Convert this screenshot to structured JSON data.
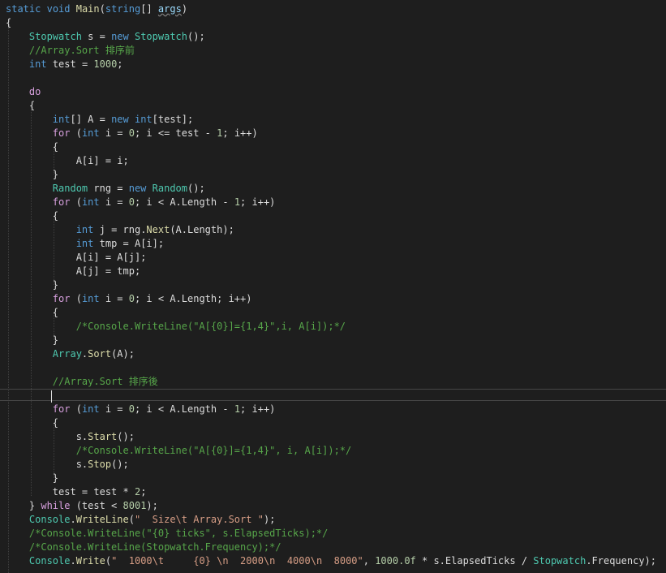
{
  "editor": {
    "lines": [
      [
        {
          "t": "static",
          "c": "kw"
        },
        {
          "t": " ",
          "c": "pl"
        },
        {
          "t": "void",
          "c": "kw"
        },
        {
          "t": " ",
          "c": "pl"
        },
        {
          "t": "Main",
          "c": "fn"
        },
        {
          "t": "(",
          "c": "pl"
        },
        {
          "t": "string",
          "c": "kw"
        },
        {
          "t": "[] ",
          "c": "pl"
        },
        {
          "t": "args",
          "c": "un"
        },
        {
          "t": ")",
          "c": "pl"
        }
      ],
      [
        {
          "t": "{",
          "c": "pl"
        }
      ],
      [
        {
          "t": "    ",
          "c": "pl"
        },
        {
          "t": "Stopwatch",
          "c": "ty"
        },
        {
          "t": " s = ",
          "c": "pl"
        },
        {
          "t": "new",
          "c": "kw"
        },
        {
          "t": " ",
          "c": "pl"
        },
        {
          "t": "Stopwatch",
          "c": "ty"
        },
        {
          "t": "();",
          "c": "pl"
        }
      ],
      [
        {
          "t": "    ",
          "c": "pl"
        },
        {
          "t": "//Array.Sort 排序前",
          "c": "cm"
        }
      ],
      [
        {
          "t": "    ",
          "c": "pl"
        },
        {
          "t": "int",
          "c": "kw"
        },
        {
          "t": " test = ",
          "c": "pl"
        },
        {
          "t": "1000",
          "c": "nm"
        },
        {
          "t": ";",
          "c": "pl"
        }
      ],
      [],
      [
        {
          "t": "    ",
          "c": "pl"
        },
        {
          "t": "do",
          "c": "ctl"
        }
      ],
      [
        {
          "t": "    {",
          "c": "pl"
        }
      ],
      [
        {
          "t": "        ",
          "c": "pl"
        },
        {
          "t": "int",
          "c": "kw"
        },
        {
          "t": "[] A = ",
          "c": "pl"
        },
        {
          "t": "new",
          "c": "kw"
        },
        {
          "t": " ",
          "c": "pl"
        },
        {
          "t": "int",
          "c": "kw"
        },
        {
          "t": "[test];",
          "c": "pl"
        }
      ],
      [
        {
          "t": "        ",
          "c": "pl"
        },
        {
          "t": "for",
          "c": "ctl"
        },
        {
          "t": " (",
          "c": "pl"
        },
        {
          "t": "int",
          "c": "kw"
        },
        {
          "t": " i = ",
          "c": "pl"
        },
        {
          "t": "0",
          "c": "nm"
        },
        {
          "t": "; i <= test - ",
          "c": "pl"
        },
        {
          "t": "1",
          "c": "nm"
        },
        {
          "t": "; i++)",
          "c": "pl"
        }
      ],
      [
        {
          "t": "        {",
          "c": "pl"
        }
      ],
      [
        {
          "t": "            A[i] = i;",
          "c": "pl"
        }
      ],
      [
        {
          "t": "        }",
          "c": "pl"
        }
      ],
      [
        {
          "t": "        ",
          "c": "pl"
        },
        {
          "t": "Random",
          "c": "ty"
        },
        {
          "t": " rng = ",
          "c": "pl"
        },
        {
          "t": "new",
          "c": "kw"
        },
        {
          "t": " ",
          "c": "pl"
        },
        {
          "t": "Random",
          "c": "ty"
        },
        {
          "t": "();",
          "c": "pl"
        }
      ],
      [
        {
          "t": "        ",
          "c": "pl"
        },
        {
          "t": "for",
          "c": "ctl"
        },
        {
          "t": " (",
          "c": "pl"
        },
        {
          "t": "int",
          "c": "kw"
        },
        {
          "t": " i = ",
          "c": "pl"
        },
        {
          "t": "0",
          "c": "nm"
        },
        {
          "t": "; i < A.Length - ",
          "c": "pl"
        },
        {
          "t": "1",
          "c": "nm"
        },
        {
          "t": "; i++)",
          "c": "pl"
        }
      ],
      [
        {
          "t": "        {",
          "c": "pl"
        }
      ],
      [
        {
          "t": "            ",
          "c": "pl"
        },
        {
          "t": "int",
          "c": "kw"
        },
        {
          "t": " j = rng.",
          "c": "pl"
        },
        {
          "t": "Next",
          "c": "fn"
        },
        {
          "t": "(A.Length);",
          "c": "pl"
        }
      ],
      [
        {
          "t": "            ",
          "c": "pl"
        },
        {
          "t": "int",
          "c": "kw"
        },
        {
          "t": " tmp = A[i];",
          "c": "pl"
        }
      ],
      [
        {
          "t": "            A[i] = A[j];",
          "c": "pl"
        }
      ],
      [
        {
          "t": "            A[j] = tmp;",
          "c": "pl"
        }
      ],
      [
        {
          "t": "        }",
          "c": "pl"
        }
      ],
      [
        {
          "t": "        ",
          "c": "pl"
        },
        {
          "t": "for",
          "c": "ctl"
        },
        {
          "t": " (",
          "c": "pl"
        },
        {
          "t": "int",
          "c": "kw"
        },
        {
          "t": " i = ",
          "c": "pl"
        },
        {
          "t": "0",
          "c": "nm"
        },
        {
          "t": "; i < A.Length; i++)",
          "c": "pl"
        }
      ],
      [
        {
          "t": "        {",
          "c": "pl"
        }
      ],
      [
        {
          "t": "            ",
          "c": "pl"
        },
        {
          "t": "/*Console.WriteLine(\"A[{0}]={1,4}\",i, A[i]);*/",
          "c": "cm"
        }
      ],
      [
        {
          "t": "        }",
          "c": "pl"
        }
      ],
      [
        {
          "t": "        ",
          "c": "pl"
        },
        {
          "t": "Array",
          "c": "ty"
        },
        {
          "t": ".",
          "c": "pl"
        },
        {
          "t": "Sort",
          "c": "fn"
        },
        {
          "t": "(A);",
          "c": "pl"
        }
      ],
      [],
      [
        {
          "t": "        ",
          "c": "pl"
        },
        {
          "t": "//Array.Sort 排序後",
          "c": "cm"
        }
      ],
      [],
      [
        {
          "t": "        ",
          "c": "pl"
        },
        {
          "t": "for",
          "c": "ctl"
        },
        {
          "t": " (",
          "c": "pl"
        },
        {
          "t": "int",
          "c": "kw"
        },
        {
          "t": " i = ",
          "c": "pl"
        },
        {
          "t": "0",
          "c": "nm"
        },
        {
          "t": "; i < A.Length - ",
          "c": "pl"
        },
        {
          "t": "1",
          "c": "nm"
        },
        {
          "t": "; i++)",
          "c": "pl"
        }
      ],
      [
        {
          "t": "        {",
          "c": "pl"
        }
      ],
      [
        {
          "t": "            s.",
          "c": "pl"
        },
        {
          "t": "Start",
          "c": "fn"
        },
        {
          "t": "();",
          "c": "pl"
        }
      ],
      [
        {
          "t": "            ",
          "c": "pl"
        },
        {
          "t": "/*Console.WriteLine(\"A[{0}]={1,4}\", i, A[i]);*/",
          "c": "cm"
        }
      ],
      [
        {
          "t": "            s.",
          "c": "pl"
        },
        {
          "t": "Stop",
          "c": "fn"
        },
        {
          "t": "();",
          "c": "pl"
        }
      ],
      [
        {
          "t": "        }",
          "c": "pl"
        }
      ],
      [
        {
          "t": "        test ",
          "c": "pl"
        },
        {
          "t": "=",
          "c": "pl"
        },
        {
          "t": " test * ",
          "c": "pl"
        },
        {
          "t": "2",
          "c": "nm"
        },
        {
          "t": ";",
          "c": "pl"
        }
      ],
      [
        {
          "t": "    } ",
          "c": "pl"
        },
        {
          "t": "while",
          "c": "ctl"
        },
        {
          "t": " (test < ",
          "c": "pl"
        },
        {
          "t": "8001",
          "c": "nm"
        },
        {
          "t": ");",
          "c": "pl"
        }
      ],
      [
        {
          "t": "    ",
          "c": "pl"
        },
        {
          "t": "Console",
          "c": "ty"
        },
        {
          "t": ".",
          "c": "pl"
        },
        {
          "t": "WriteLine",
          "c": "fn"
        },
        {
          "t": "(",
          "c": "pl"
        },
        {
          "t": "\"  Size\\t Array.Sort \"",
          "c": "st"
        },
        {
          "t": ");",
          "c": "pl"
        }
      ],
      [
        {
          "t": "    ",
          "c": "pl"
        },
        {
          "t": "/*Console.WriteLine(\"{0} ticks\", s.ElapsedTicks);*/",
          "c": "cm"
        }
      ],
      [
        {
          "t": "    ",
          "c": "pl"
        },
        {
          "t": "/*Console.WriteLine(Stopwatch.Frequency);*/",
          "c": "cm"
        }
      ],
      [
        {
          "t": "    ",
          "c": "pl"
        },
        {
          "t": "Console",
          "c": "ty"
        },
        {
          "t": ".",
          "c": "pl"
        },
        {
          "t": "Write",
          "c": "fn"
        },
        {
          "t": "(",
          "c": "pl"
        },
        {
          "t": "\"  1000\\t     {0} \\n  2000\\n  4000\\n  8000\"",
          "c": "st"
        },
        {
          "t": ", ",
          "c": "pl"
        },
        {
          "t": "1000.0f",
          "c": "nm"
        },
        {
          "t": " * s.ElapsedTicks / ",
          "c": "pl"
        },
        {
          "t": "Stopwatch",
          "c": "ty"
        },
        {
          "t": ".Frequency);",
          "c": "pl"
        }
      ]
    ]
  }
}
